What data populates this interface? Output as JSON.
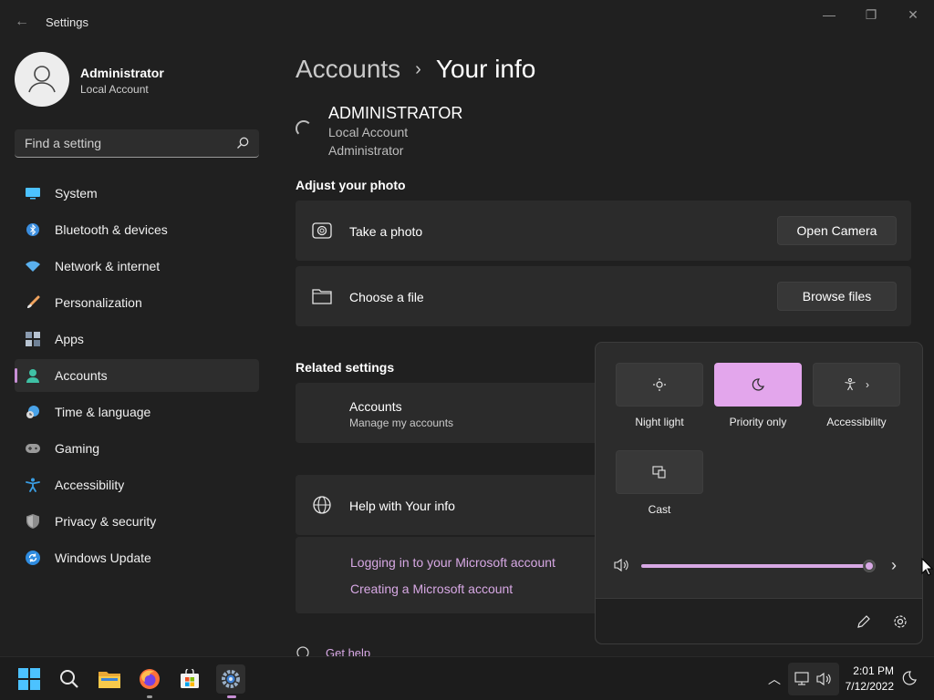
{
  "window": {
    "title": "Settings",
    "back_glyph": "←",
    "minimize_glyph": "—",
    "maximize_glyph": "❐",
    "close_glyph": "✕"
  },
  "profile": {
    "name": "Administrator",
    "type": "Local Account"
  },
  "search": {
    "placeholder": "Find a setting"
  },
  "sidebar": {
    "items": [
      {
        "label": "System",
        "icon": "monitor-icon",
        "color": "#4cc2ff"
      },
      {
        "label": "Bluetooth & devices",
        "icon": "bluetooth-icon",
        "color": "#3a8dde"
      },
      {
        "label": "Network & internet",
        "icon": "wifi-icon",
        "color": "#5ab1ef"
      },
      {
        "label": "Personalization",
        "icon": "brush-icon",
        "color": "#f0a35e"
      },
      {
        "label": "Apps",
        "icon": "apps-icon",
        "color": "#8a9bb0"
      },
      {
        "label": "Accounts",
        "icon": "person-icon",
        "color": "#3fc1a5",
        "active": true
      },
      {
        "label": "Time & language",
        "icon": "globe-clock-icon",
        "color": "#4aa3e8"
      },
      {
        "label": "Gaming",
        "icon": "gamepad-icon",
        "color": "#9a9a9a"
      },
      {
        "label": "Accessibility",
        "icon": "accessibility-icon",
        "color": "#3a9ee4"
      },
      {
        "label": "Privacy & security",
        "icon": "shield-icon",
        "color": "#8c8c8c"
      },
      {
        "label": "Windows Update",
        "icon": "sync-icon",
        "color": "#2f8ce0"
      }
    ]
  },
  "breadcrumb": {
    "parent": "Accounts",
    "separator": "›",
    "current": "Your info"
  },
  "account": {
    "name": "ADMINISTRATOR",
    "type": "Local Account",
    "role": "Administrator"
  },
  "photo": {
    "section_title": "Adjust your photo",
    "take_label": "Take a photo",
    "take_button": "Open Camera",
    "file_label": "Choose a file",
    "file_button": "Browse files"
  },
  "related": {
    "section_title": "Related settings",
    "accounts_label": "Accounts",
    "accounts_sub": "Manage my accounts"
  },
  "help": {
    "title": "Help with Your info",
    "links": [
      "Logging in to your Microsoft account",
      "Creating a Microsoft account"
    ],
    "get_help": "Get help"
  },
  "quick_settings": {
    "tiles": [
      {
        "label": "Night light",
        "icon": "brightness-icon",
        "on": false
      },
      {
        "label": "Priority only",
        "icon": "moon-icon",
        "on": true
      },
      {
        "label": "Accessibility",
        "icon": "accessibility-icon",
        "on": false
      },
      {
        "label": "Cast",
        "icon": "cast-icon",
        "on": false
      }
    ],
    "volume_percent": 100,
    "accent": "#d7a8e4"
  },
  "taskbar": {
    "time": "2:01 PM",
    "date": "7/12/2022"
  }
}
